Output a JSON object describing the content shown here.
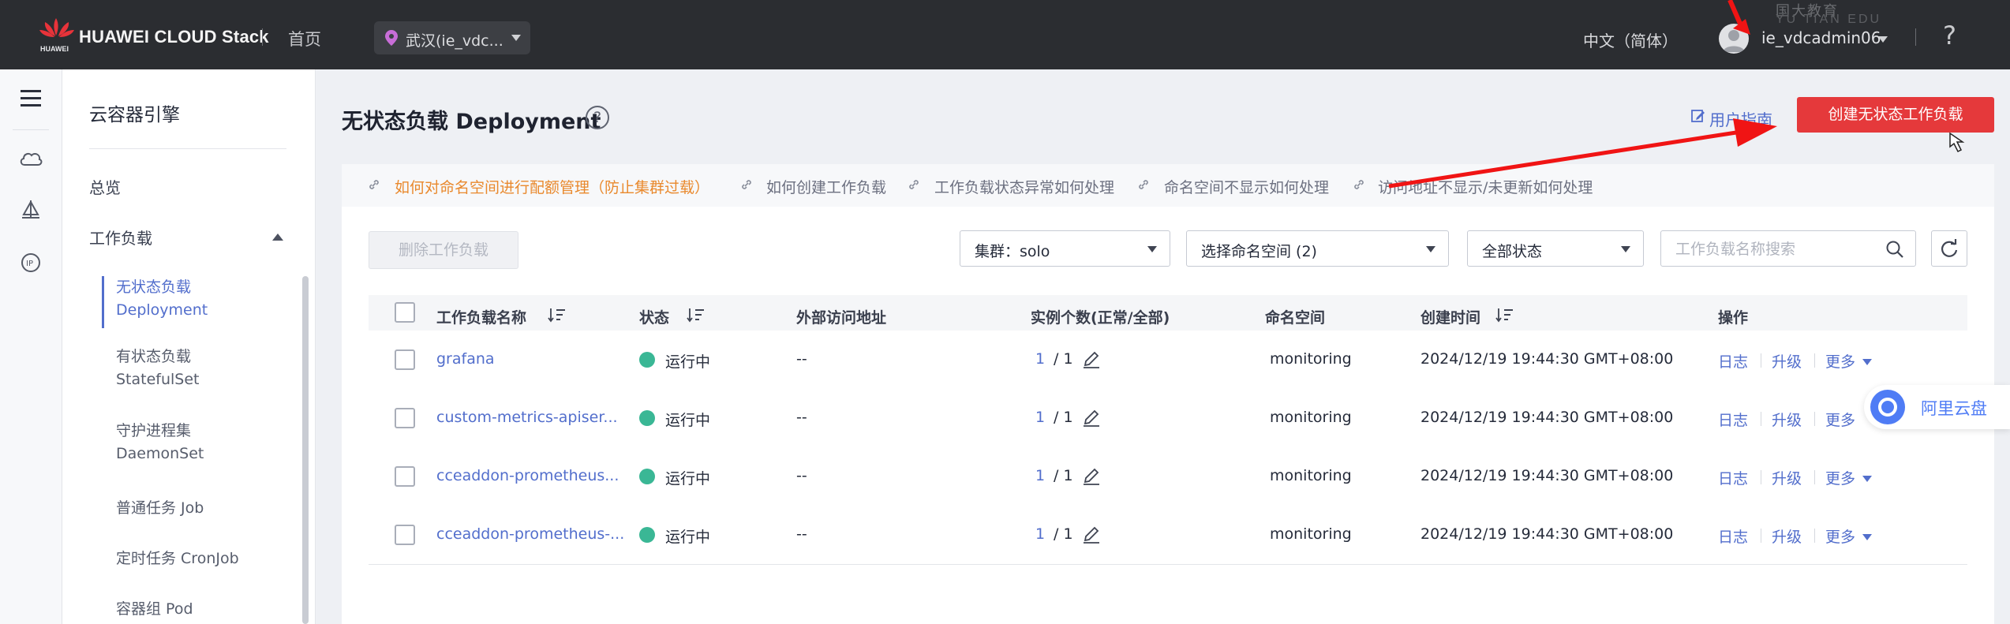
{
  "topbar": {
    "brand": "HUAWEI CLOUD Stack",
    "home": "首页",
    "region": "武汉(ie_vdc...",
    "language": "中文（简体）",
    "username": "ie_vdcadmin06",
    "help": "?"
  },
  "sidebar": {
    "title": "云容器引擎",
    "overview": "总览",
    "workloads": "工作负载",
    "items": [
      {
        "line1": "无状态负载",
        "line2": "Deployment"
      },
      {
        "line1": "有状态负载",
        "line2": "StatefulSet"
      },
      {
        "line1": "守护进程集",
        "line2": "DaemonSet"
      },
      {
        "line1": "普通任务 Job"
      },
      {
        "line1": "定时任务 CronJob"
      },
      {
        "line1": "容器组 Pod"
      }
    ]
  },
  "header": {
    "title": "无状态负载 Deployment",
    "user_guide": "用户指南",
    "create_button": "创建无状态工作负载"
  },
  "tips": [
    "如何对命名空间进行配额管理（防止集群过载）",
    "如何创建工作负载",
    "工作负载状态异常如何处理",
    "命名空间不显示如何处理",
    "访问地址不显示/未更新如何处理"
  ],
  "toolbar": {
    "delete_button": "删除工作负载",
    "cluster_select": "集群：solo",
    "namespace_select": "选择命名空间 (2)",
    "status_select": "全部状态",
    "search_placeholder": "工作负载名称搜索"
  },
  "table": {
    "columns": [
      "工作负载名称",
      "状态",
      "外部访问地址",
      "实例个数(正常/全部)",
      "命名空间",
      "创建时间",
      "操作"
    ],
    "rows": [
      {
        "name": "grafana",
        "status": "运行中",
        "address": "--",
        "normal": "1",
        "total": "/ 1",
        "namespace": "monitoring",
        "created": "2024/12/19 19:44:30 GMT+08:00"
      },
      {
        "name": "custom-metrics-apiser...",
        "status": "运行中",
        "address": "--",
        "normal": "1",
        "total": "/ 1",
        "namespace": "monitoring",
        "created": "2024/12/19 19:44:30 GMT+08:00"
      },
      {
        "name": "cceaddon-prometheus...",
        "status": "运行中",
        "address": "--",
        "normal": "1",
        "total": "/ 1",
        "namespace": "monitoring",
        "created": "2024/12/19 19:44:30 GMT+08:00"
      },
      {
        "name": "cceaddon-prometheus-...",
        "status": "运行中",
        "address": "--",
        "normal": "1",
        "total": "/ 1",
        "namespace": "monitoring",
        "created": "2024/12/19 19:44:30 GMT+08:00"
      }
    ],
    "actions": {
      "log": "日志",
      "upgrade": "升级",
      "more": "更多"
    }
  },
  "overlay": {
    "aliyun_label": "阿里云盘",
    "watermark_line1": "国大教育",
    "watermark_line2": "YU TIAN EDU"
  },
  "colors": {
    "accent": "#526ecc",
    "create_button": "#e5393b",
    "running": "#3ab795",
    "tip_highlight": "#e9892d"
  }
}
